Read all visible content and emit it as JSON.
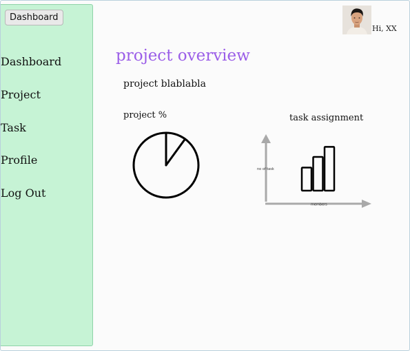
{
  "header": {
    "dashboard_button": "Dashboard",
    "greeting": "Hi, XX"
  },
  "sidebar": {
    "items": [
      {
        "label": "Dashboard"
      },
      {
        "label": "Project"
      },
      {
        "label": "Task"
      },
      {
        "label": "Profile"
      },
      {
        "label": "Log Out"
      }
    ]
  },
  "main": {
    "title": "project overview",
    "project_name": "project blablabla",
    "progress_label": "project %",
    "task_label": "task assignment"
  },
  "chart_data": [
    {
      "type": "pie",
      "title": "project %",
      "slices": [
        {
          "label": "",
          "value": 10
        },
        {
          "label": "",
          "value": 90
        }
      ]
    },
    {
      "type": "bar",
      "title": "task assignment",
      "xlabel": "members",
      "ylabel": "no of task",
      "categories": [
        "",
        "",
        ""
      ],
      "values": [
        39,
        57,
        74
      ],
      "ylim": [
        0,
        100
      ]
    }
  ],
  "colors": {
    "accent": "#9b5ee8",
    "sidebar_bg": "#c6f3d5",
    "axis": "#a9a9a9"
  }
}
